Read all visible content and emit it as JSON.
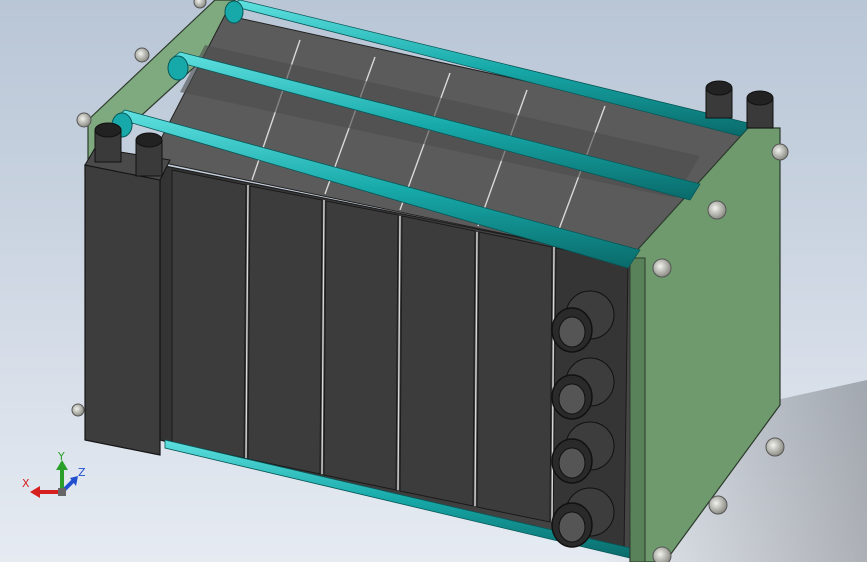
{
  "viewport": {
    "background_top": "#b9c6d6",
    "background_bottom": "#e6ebf2"
  },
  "model": {
    "plate_color": "#6e9a6e",
    "plate_edge_color": "#2c3a2c",
    "rod_color": "#17a9a9",
    "cell_color": "#3f3f3f",
    "cell_top_color": "#5a5a5a",
    "fitting_color": "#3a3a3a",
    "bolt_color": "#c8c8c0",
    "cell_count": 6
  },
  "triad": {
    "x_label": "X",
    "y_label": "Y",
    "z_label": "Z",
    "x_color": "#d62020",
    "y_color": "#2aa02a",
    "z_color": "#2050d0"
  }
}
